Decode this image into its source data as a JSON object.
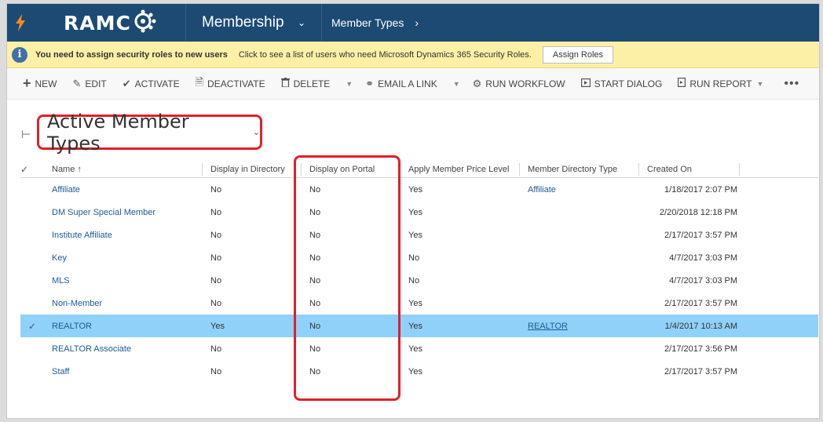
{
  "nav": {
    "logo": "RAMC",
    "module": "Membership",
    "entity": "Member Types"
  },
  "notification": {
    "message": "You need to assign security roles to new users",
    "link_text": "Click to see a list of users who need Microsoft Dynamics 365 Security Roles.",
    "button": "Assign Roles"
  },
  "commands": [
    {
      "label": "NEW",
      "icon": "plus-icon"
    },
    {
      "label": "EDIT",
      "icon": "pencil-icon"
    },
    {
      "label": "ACTIVATE",
      "icon": "check-icon"
    },
    {
      "label": "DEACTIVATE",
      "icon": "document-icon"
    },
    {
      "label": "DELETE",
      "icon": "trash-icon"
    },
    {
      "label": "EMAIL A LINK",
      "icon": "link-icon"
    },
    {
      "label": "RUN WORKFLOW",
      "icon": "workflow-icon"
    },
    {
      "label": "START DIALOG",
      "icon": "dialog-icon"
    },
    {
      "label": "RUN REPORT",
      "icon": "report-icon"
    }
  ],
  "view": {
    "title": "Active Member Types"
  },
  "grid": {
    "columns": [
      "Name ↑",
      "Display in Directory",
      "Display on Portal",
      "Apply Member Price Level",
      "Member Directory Type",
      "Created On"
    ],
    "rows": [
      {
        "name": "Affiliate",
        "dir": "No",
        "portal": "No",
        "price": "Yes",
        "mdt": "Affiliate",
        "created": "1/18/2017 2:07 PM",
        "selected": false
      },
      {
        "name": "DM Super Special Member",
        "dir": "No",
        "portal": "No",
        "price": "Yes",
        "mdt": "",
        "created": "2/20/2018 12:18 PM",
        "selected": false
      },
      {
        "name": "Institute Affiliate",
        "dir": "No",
        "portal": "No",
        "price": "Yes",
        "mdt": "",
        "created": "2/17/2017 3:57 PM",
        "selected": false
      },
      {
        "name": "Key",
        "dir": "No",
        "portal": "No",
        "price": "No",
        "mdt": "",
        "created": "4/7/2017 3:03 PM",
        "selected": false
      },
      {
        "name": "MLS",
        "dir": "No",
        "portal": "No",
        "price": "No",
        "mdt": "",
        "created": "4/7/2017 3:03 PM",
        "selected": false
      },
      {
        "name": "Non-Member",
        "dir": "No",
        "portal": "No",
        "price": "Yes",
        "mdt": "",
        "created": "2/17/2017 3:57 PM",
        "selected": false
      },
      {
        "name": "REALTOR",
        "dir": "Yes",
        "portal": "No",
        "price": "Yes",
        "mdt": "REALTOR",
        "created": "1/4/2017 10:13 AM",
        "selected": true
      },
      {
        "name": "REALTOR Associate",
        "dir": "No",
        "portal": "No",
        "price": "Yes",
        "mdt": "",
        "created": "2/17/2017 3:56 PM",
        "selected": false
      },
      {
        "name": "Staff",
        "dir": "No",
        "portal": "No",
        "price": "Yes",
        "mdt": "",
        "created": "2/17/2017 3:57 PM",
        "selected": false
      }
    ]
  },
  "colors": {
    "nav_bg": "#1c4a73",
    "notif_bg": "#fbf0a6",
    "selected_row": "#8fd1f9",
    "highlight": "#e0202a",
    "bolt": "#f28a1e"
  }
}
